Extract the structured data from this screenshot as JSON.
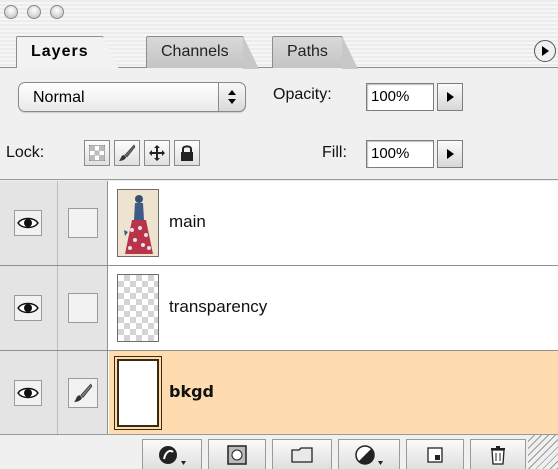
{
  "tabs": [
    {
      "label": "Layers",
      "active": true
    },
    {
      "label": "Channels",
      "active": false
    },
    {
      "label": "Paths",
      "active": false
    }
  ],
  "blend": {
    "mode": "Normal"
  },
  "opacity": {
    "label": "Opacity:",
    "value": "100%"
  },
  "fill": {
    "label": "Fill:",
    "value": "100%"
  },
  "lock": {
    "label": "Lock:"
  },
  "layers": [
    {
      "name": "main",
      "visible": true,
      "selected": false
    },
    {
      "name": "transparency",
      "visible": true,
      "selected": false
    },
    {
      "name": "bkgd",
      "visible": true,
      "selected": true
    }
  ],
  "icons": {
    "palette_menu": "triangle-right-icon",
    "eye": "eye-icon",
    "brush": "brush-icon",
    "toolbar": [
      "layer-style-icon",
      "layer-mask-icon",
      "new-group-folder-icon",
      "adjustment-layer-icon",
      "new-layer-icon",
      "trash-icon"
    ]
  },
  "colors": {
    "selected_row": "#ffdcb0",
    "panel_bg": "#f0f0f0"
  }
}
